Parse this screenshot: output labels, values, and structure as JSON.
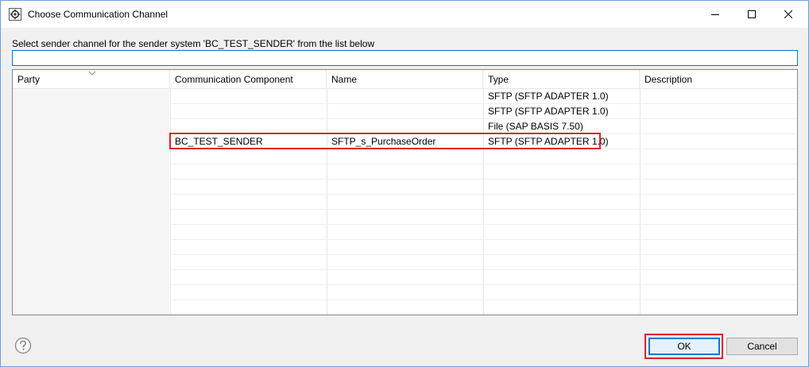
{
  "dialog": {
    "title": "Choose Communication Channel",
    "instruction": "Select sender channel for the sender system 'BC_TEST_SENDER' from the list below",
    "filter": {
      "value": "",
      "placeholder": ""
    }
  },
  "window_controls": [
    "minimize-icon",
    "maximize-icon",
    "close-icon"
  ],
  "table": {
    "columns": [
      "Party",
      "Communication Component",
      "Name",
      "Type",
      "Description"
    ],
    "sorted_column": "Party",
    "rows": [
      {
        "party": "",
        "component": "",
        "name": "",
        "type": "SFTP (SFTP ADAPTER 1.0)",
        "description": ""
      },
      {
        "party": "",
        "component": "",
        "name": "",
        "type": "SFTP (SFTP ADAPTER 1.0)",
        "description": ""
      },
      {
        "party": "",
        "component": "",
        "name": "",
        "type": "File (SAP BASIS 7.50)",
        "description": ""
      },
      {
        "party": "",
        "component": "BC_TEST_SENDER",
        "name": "SFTP_s_PurchaseOrder",
        "type": "SFTP (SFTP ADAPTER 1.0)",
        "description": ""
      }
    ],
    "highlighted_row_index": 3
  },
  "footer": {
    "ok_label": "OK",
    "cancel_label": "Cancel",
    "help_icon": "help-icon"
  },
  "colors": {
    "highlight": "#d9232e",
    "focus_border": "#0078d7",
    "window_border": "#6f9ed6"
  }
}
